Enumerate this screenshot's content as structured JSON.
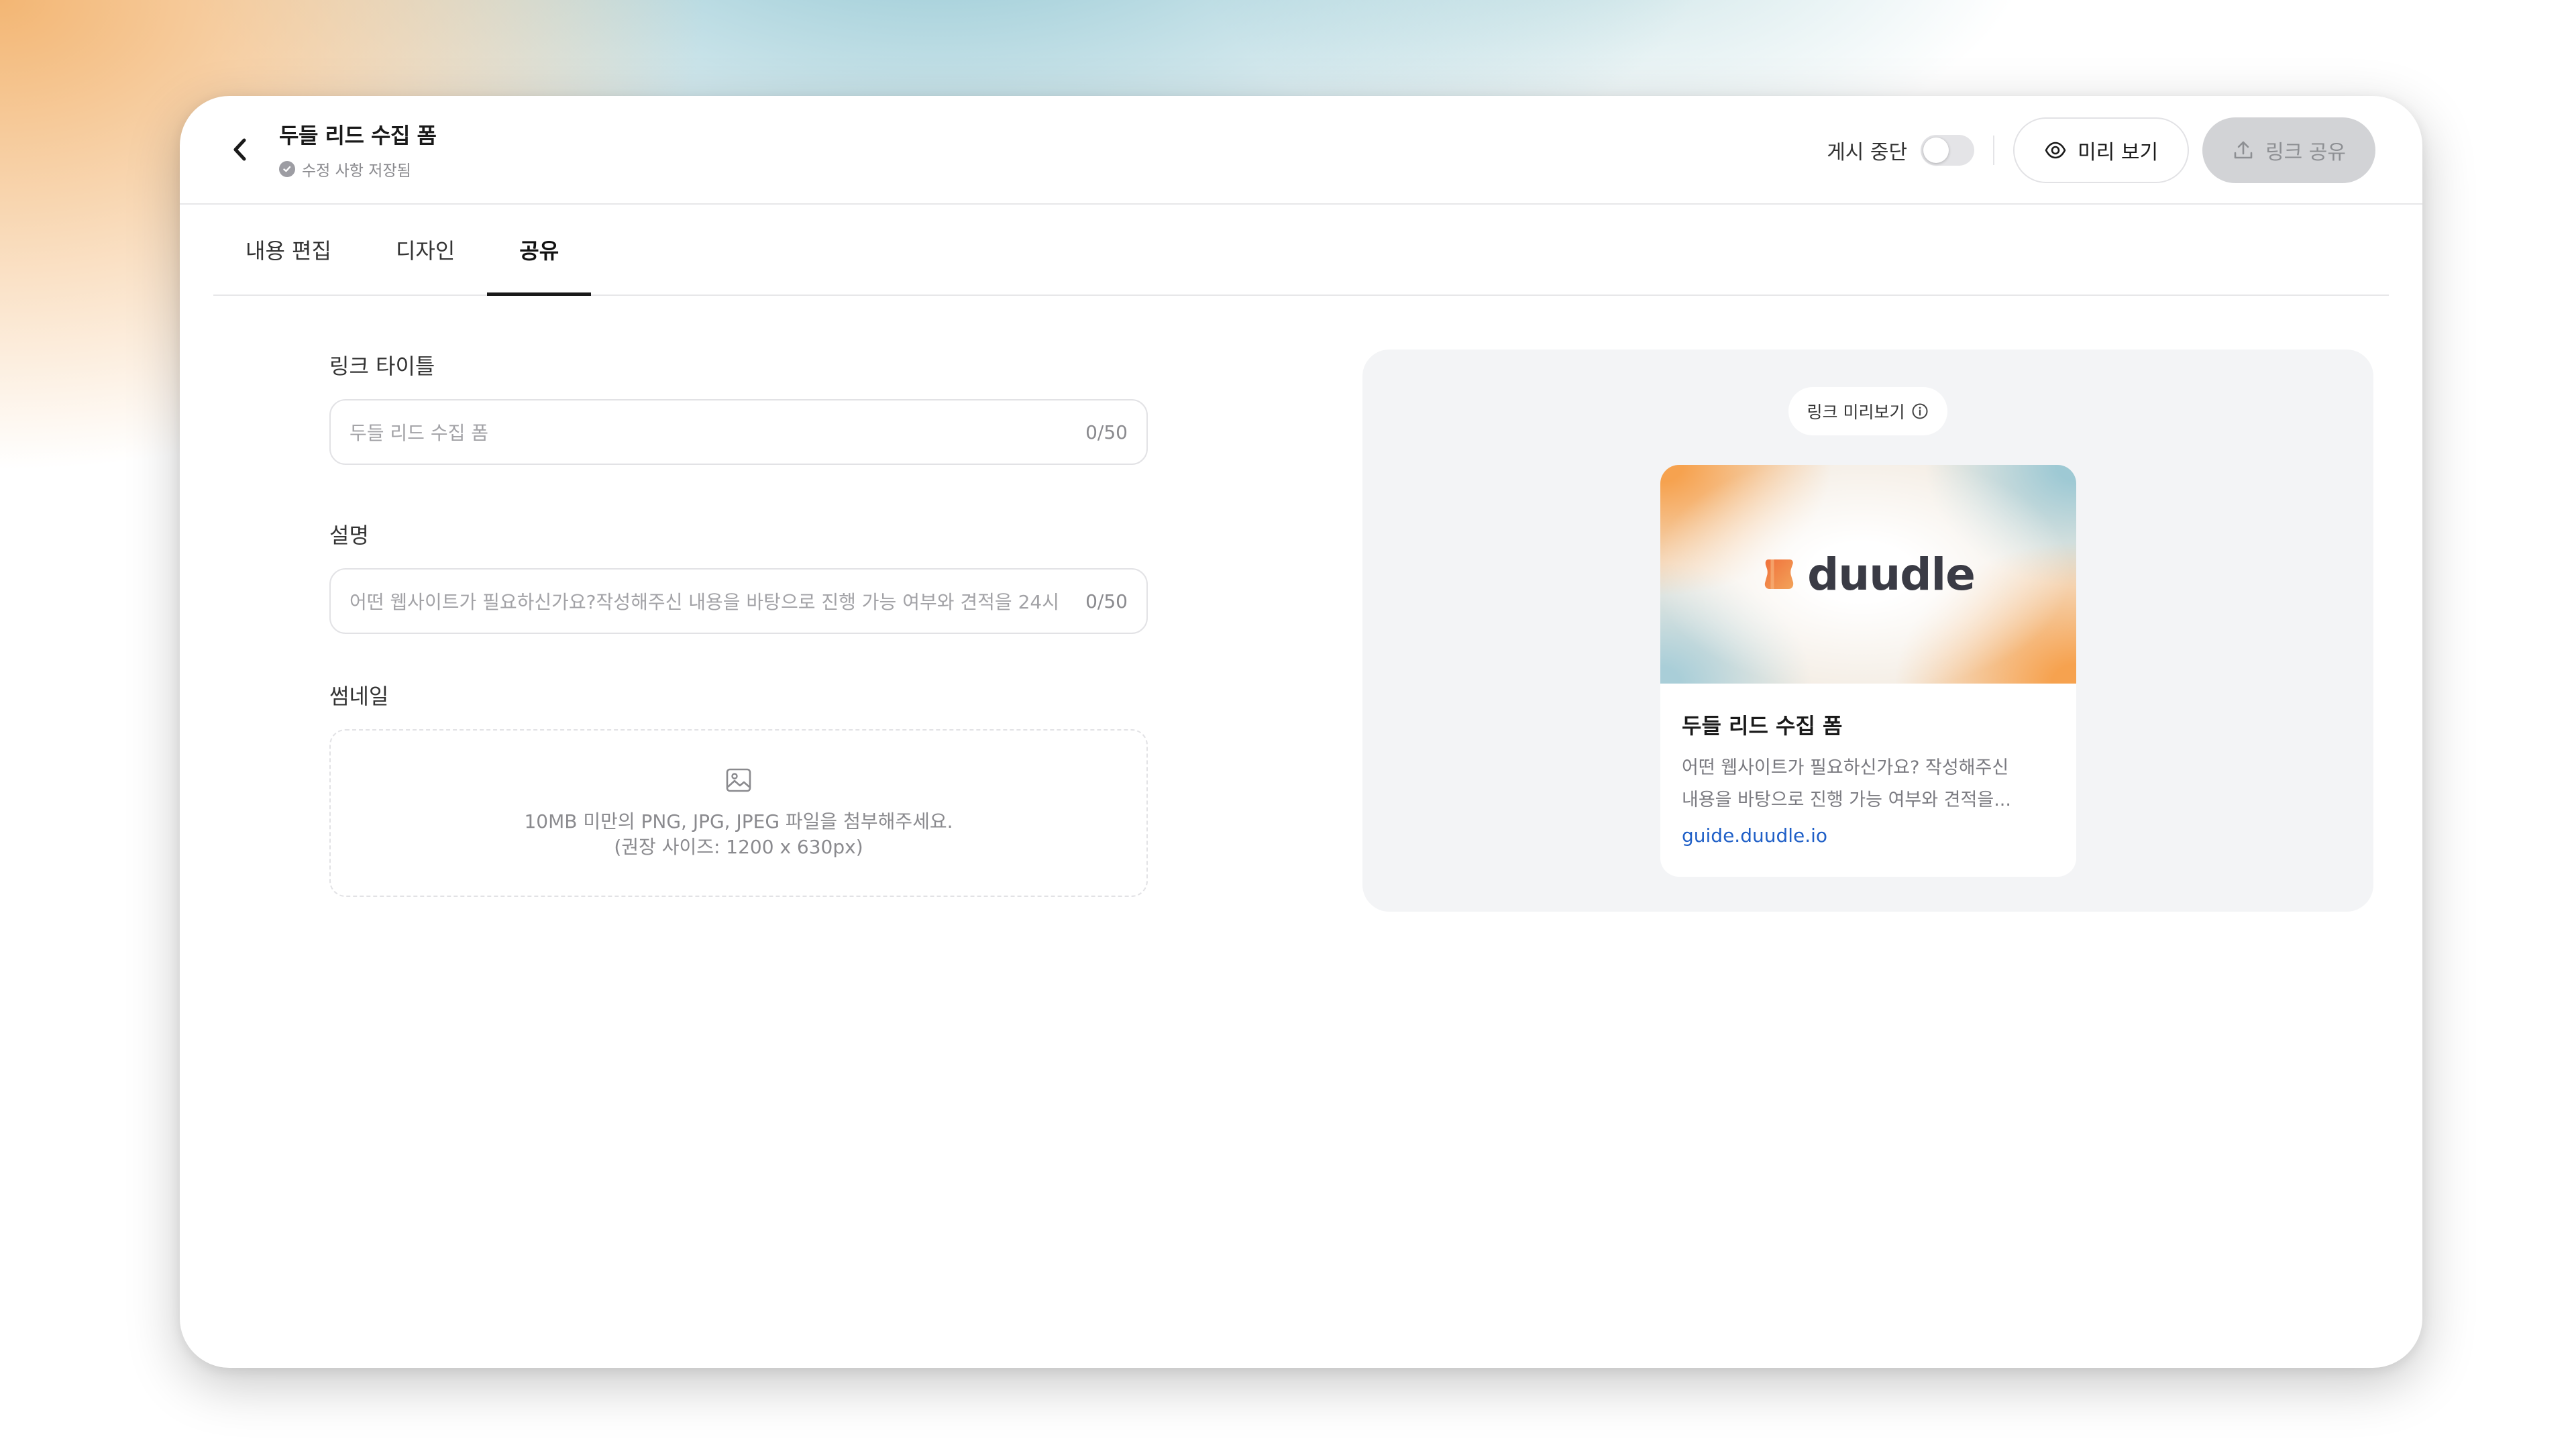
{
  "header": {
    "title": "두들 리드 수집 폼",
    "save_status": "수정 사항 저장됨",
    "unpublish_label": "게시 중단",
    "preview_label": "미리 보기",
    "share_label": "링크 공유"
  },
  "tabs": [
    {
      "label": "내용 편집",
      "active": false
    },
    {
      "label": "디자인",
      "active": false
    },
    {
      "label": "공유",
      "active": true
    }
  ],
  "form": {
    "link_title": {
      "label": "링크 타이틀",
      "placeholder": "두들 리드 수집 폼",
      "count": "0/50"
    },
    "description": {
      "label": "설명",
      "placeholder": "어떤 웹사이트가 필요하신가요?작성해주신 내용을 바탕으로 진행 가능 여부와 견적을 24시",
      "count": "0/50"
    },
    "thumbnail": {
      "label": "썸네일",
      "hint_line1": "10MB 미만의 PNG, JPG, JPEG 파일을 첨부해주세요.",
      "hint_line2": "(권장 사이즈: 1200 x 630px)"
    }
  },
  "preview": {
    "pill_label": "링크 미리보기",
    "brand_name": "duudle",
    "card_title": "두들 리드 수집 폼",
    "card_desc_line1": "어떤 웹사이트가 필요하신가요? 작성해주신",
    "card_desc_line2": "내용을 바탕으로 진행 가능 여부와 견적을...",
    "card_link": "guide.duudle.io"
  },
  "colors": {
    "accent_link": "#1f5fc7",
    "toggle_off": "#e4e4e7",
    "share_button_disabled": "#d2d3d6"
  }
}
